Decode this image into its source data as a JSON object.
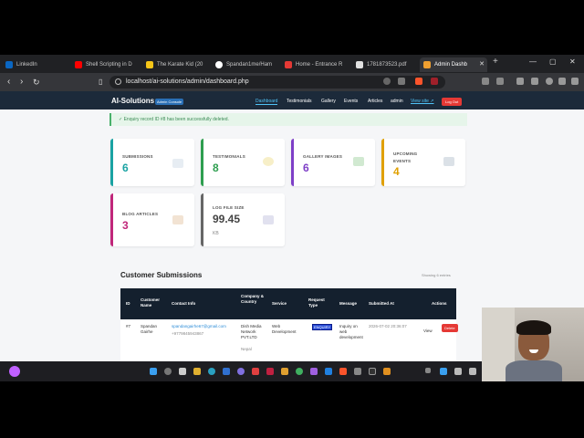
{
  "browser": {
    "tabs": [
      {
        "label": "LinkedIn",
        "color": "#0a66c2"
      },
      {
        "label": "Shell Scripting in D",
        "color": "#ff0000"
      },
      {
        "label": "The Karate Kid (20",
        "color": "#f5c518"
      },
      {
        "label": "Spandan1me/Ham",
        "color": "#ffffff"
      },
      {
        "label": "Home - Entrance R",
        "color": "#e53935"
      },
      {
        "label": "1781873523.pdf",
        "color": "#e0e0e0"
      },
      {
        "label": "Admin Dashb",
        "color": "#f0a030"
      }
    ],
    "new_tab": "+",
    "url": "localhost/ai-solutions/admin/dashboard.php"
  },
  "site": {
    "brand": "AI-Solutions",
    "badge": "Admin Console",
    "nav": [
      "Dashboard",
      "Testimonials",
      "Gallery",
      "Events",
      "Articles",
      "admin",
      "View site ↗"
    ],
    "logout": "Log Out",
    "alert": "✓  Enquiry record ID #8 has been successfully deleted.",
    "stats": [
      {
        "label": "SUBMISSIONS",
        "value": "6",
        "color": "#1aa3a3"
      },
      {
        "label": "TESTIMONIALS",
        "value": "8",
        "color": "#2e9e4f"
      },
      {
        "label": "GALLERY IMAGES",
        "value": "6",
        "color": "#7e3fc7"
      },
      {
        "label": "UPCOMING EVENTS",
        "value": "4",
        "color": "#e0a000"
      },
      {
        "label": "BLOG ARTICLES",
        "value": "3",
        "color": "#c0267a"
      },
      {
        "label": "LOG FILE SIZE",
        "value": "99.45",
        "unit": "KB",
        "color": "#666666"
      }
    ],
    "submissions": {
      "title": "Customer Submissions",
      "count": "Showing 6 entries",
      "headers": [
        "ID",
        "Customer Name",
        "Contact Info",
        "Company & Country",
        "Service",
        "Request Type",
        "Message",
        "Submitted At",
        "Actions"
      ],
      "row": {
        "id": "#7",
        "name": "Spandan Gairhe",
        "email": "spandangairhe67@gmail.com",
        "phone": "+9779845943867",
        "company": "Dish Media Network PVT.LTD",
        "country": "Nepal",
        "service": "Web Development",
        "request_type": "ENQUIRY",
        "message": "Inquiry on web development",
        "submitted_at": "2026-07-02 20:36:07",
        "view": "View",
        "delete": "Delete"
      }
    }
  }
}
